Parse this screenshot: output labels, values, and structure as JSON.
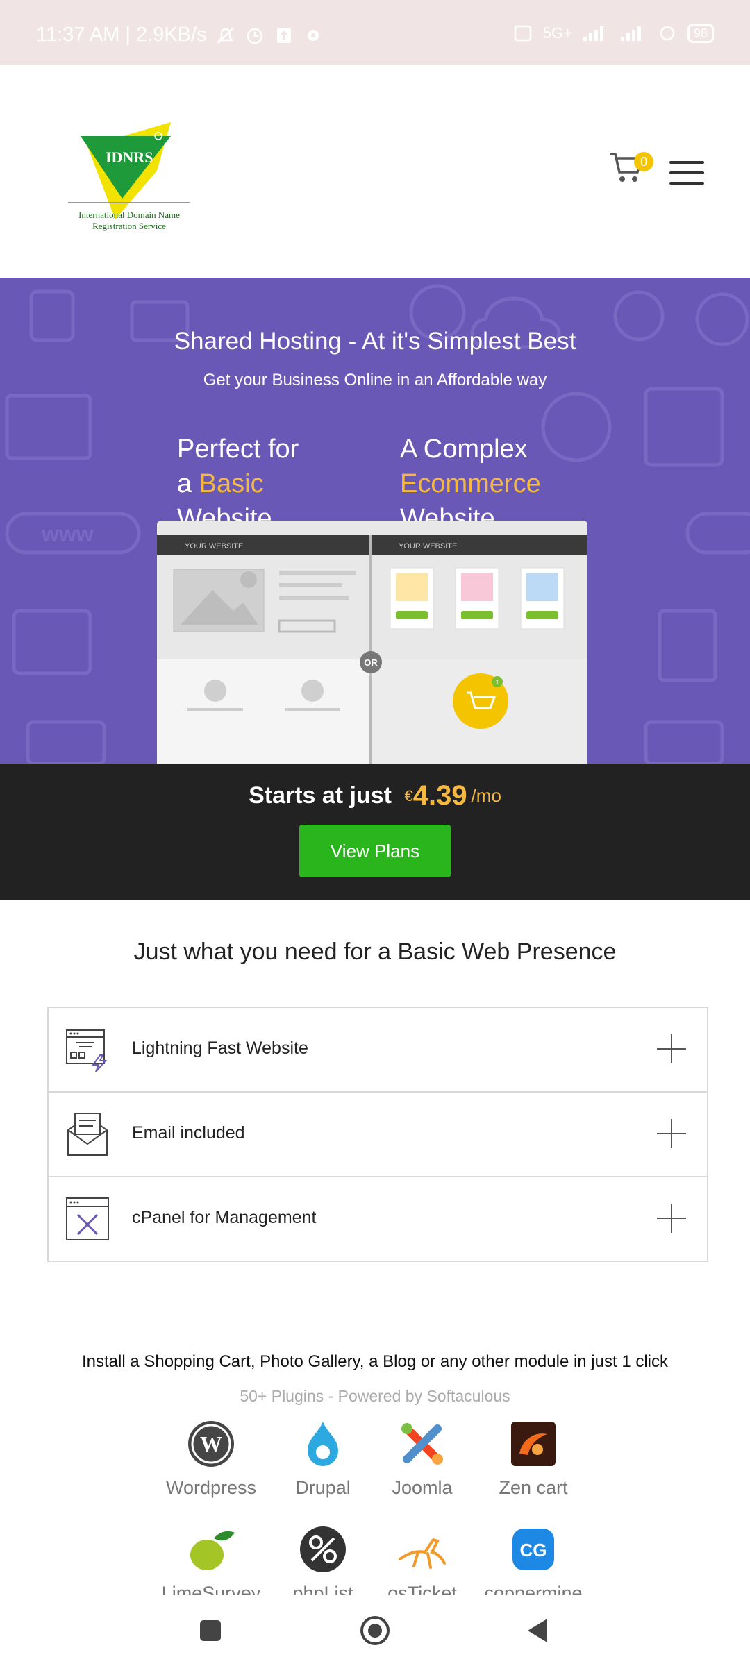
{
  "status_bar": {
    "time_speed": "11:37 AM | 2.9KB/s",
    "battery": "98",
    "network": "5G+"
  },
  "header": {
    "logo_title": "IDNRS",
    "logo_sub": "International Domain Name Registration Service",
    "cart_count": "0"
  },
  "hero": {
    "title": "Shared Hosting - At it's Simplest Best",
    "subtitle": "Get your Business Online in an Affordable way",
    "left_option": {
      "line1": "Perfect for",
      "prefix": "a ",
      "highlight": "Basic",
      "line3": "Website"
    },
    "right_option": {
      "line1": "A Complex",
      "highlight": "Ecommerce",
      "line3": "Website"
    },
    "mock_label_left": "YOUR WEBSITE",
    "mock_label_right": "YOUR WEBSITE",
    "or_label": "OR",
    "cart_badge": "1"
  },
  "pricing": {
    "lead": "Starts at just",
    "currency": "€",
    "price": "4.39",
    "period": "/mo",
    "button": "View Plans"
  },
  "features_section": {
    "title": "Just what you need for a Basic Web Presence",
    "items": [
      {
        "label": "Lightning Fast Website",
        "icon": "lightning-website-icon"
      },
      {
        "label": "Email included",
        "icon": "email-envelope-icon"
      },
      {
        "label": "cPanel for Management",
        "icon": "cpanel-tools-icon"
      }
    ]
  },
  "plugins_section": {
    "install_text": "Install a Shopping Cart, Photo Gallery, a Blog or any other module in just 1 click",
    "subtitle": "50+ Plugins - Powered by Softaculous",
    "items": [
      {
        "name": "Wordpress",
        "icon": "wordpress-icon"
      },
      {
        "name": "Drupal",
        "icon": "drupal-icon"
      },
      {
        "name": "Joomla",
        "icon": "joomla-icon"
      },
      {
        "name": "Zen cart",
        "icon": "zencart-icon"
      },
      {
        "name": "LimeSurvey",
        "icon": "limesurvey-icon"
      },
      {
        "name": "phpList",
        "icon": "phplist-icon"
      },
      {
        "name": "osTicket",
        "icon": "osticket-icon"
      },
      {
        "name": "coppermine",
        "icon": "coppermine-icon"
      }
    ]
  },
  "colors": {
    "hero_bg": "#6a58b6",
    "highlight": "#f5b942",
    "button_green": "#2ab51c",
    "price_band": "#222222"
  }
}
